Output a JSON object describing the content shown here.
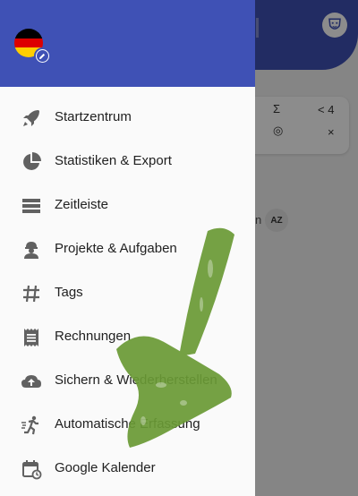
{
  "background": {
    "card": {
      "sigma": "Σ",
      "lt": "< 4",
      "close": "×"
    },
    "sort_badge": "AZ",
    "partial_text": "n"
  },
  "drawer": {
    "flag_icon": "germany-flag-icon",
    "items": [
      {
        "label": "Startzentrum",
        "icon": "rocket-icon"
      },
      {
        "label": "Statistiken & Export",
        "icon": "pie-chart-icon"
      },
      {
        "label": "Zeitleiste",
        "icon": "timeline-list-icon"
      },
      {
        "label": "Projekte & Aufgaben",
        "icon": "worker-icon"
      },
      {
        "label": "Tags",
        "icon": "hashtag-icon"
      },
      {
        "label": "Rechnungen",
        "icon": "receipt-icon"
      },
      {
        "label": "Sichern & Wiederherstellen",
        "icon": "cloud-upload-icon"
      },
      {
        "label": "Automatische Erfassung",
        "icon": "running-icon"
      },
      {
        "label": "Google Kalender",
        "icon": "calendar-sync-icon"
      }
    ]
  },
  "colors": {
    "primary": "#3f51b5",
    "scribble": "#6a9a35"
  }
}
